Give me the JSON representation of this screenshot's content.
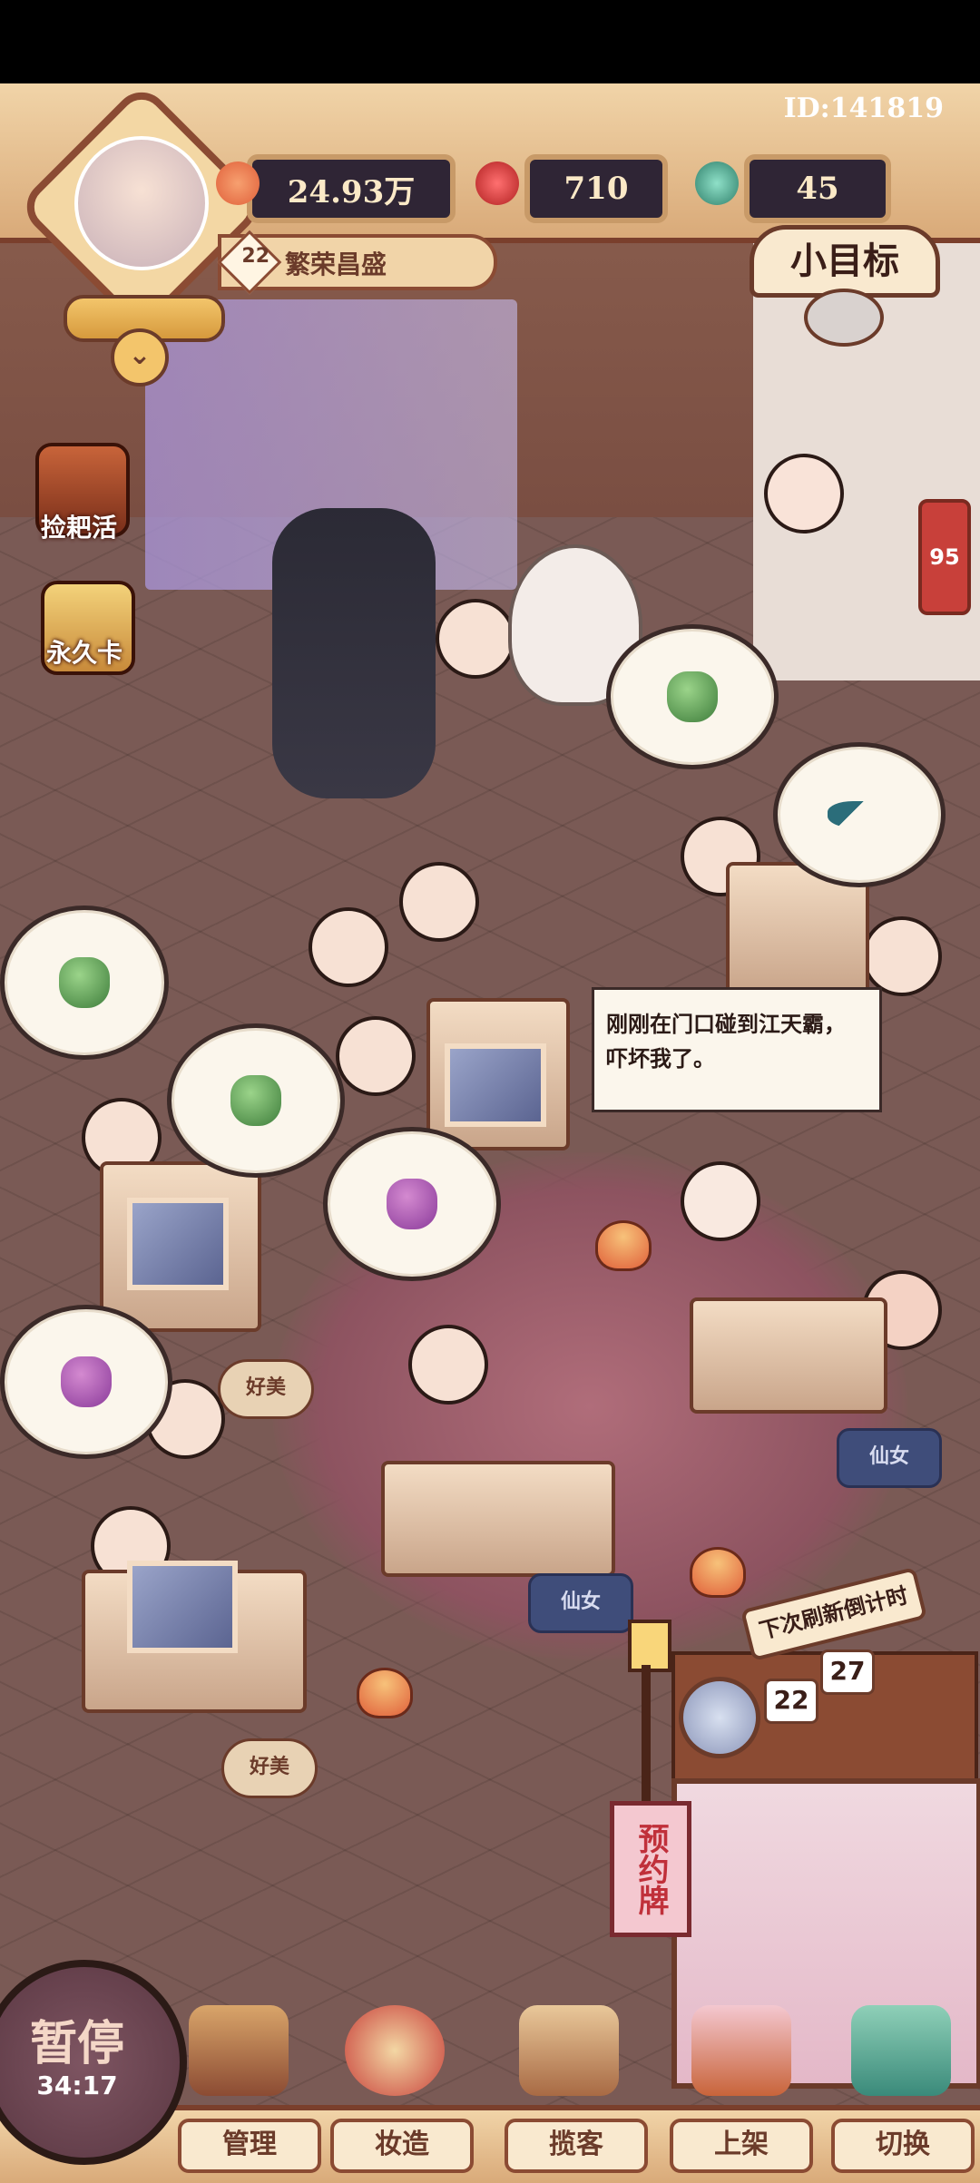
{
  "header": {
    "player_id": "ID:141819",
    "resources": [
      {
        "name": "prosperity",
        "value": "24.93万",
        "icon": "heart-coin-icon",
        "color": "#e0603a"
      },
      {
        "name": "apple",
        "value": "710",
        "icon": "red-fruit-icon",
        "color": "#d03030"
      },
      {
        "name": "gem",
        "value": "45",
        "icon": "jade-gem-icon",
        "color": "#3aa08a"
      }
    ],
    "level": "22",
    "level_title": "繁荣昌盛"
  },
  "goal": {
    "label": "小目标"
  },
  "side_buttons": [
    {
      "label": "捡耙活",
      "icon": "treasure-chest-icon"
    },
    {
      "label": "永久卡",
      "icon": "card-icon"
    }
  ],
  "badge_count": "95",
  "dialog": {
    "text": "刚刚在门口碰到江天霸，吓坏我了。"
  },
  "cushion_label": "仙女",
  "tag_label": "好美",
  "reservation_sign": "预约牌",
  "countdown": {
    "label": "下次刷新倒计时",
    "hours": "22",
    "minutes": "27"
  },
  "pause": {
    "label": "暂停",
    "timer": "34:17"
  },
  "nav": [
    {
      "label": "管理",
      "icon": "management-icon"
    },
    {
      "label": "妆造",
      "icon": "makeup-icon"
    },
    {
      "label": "揽客",
      "icon": "signpost-icon"
    },
    {
      "label": "上架",
      "icon": "shelf-icon"
    },
    {
      "label": "切换",
      "icon": "switch-icon"
    }
  ]
}
